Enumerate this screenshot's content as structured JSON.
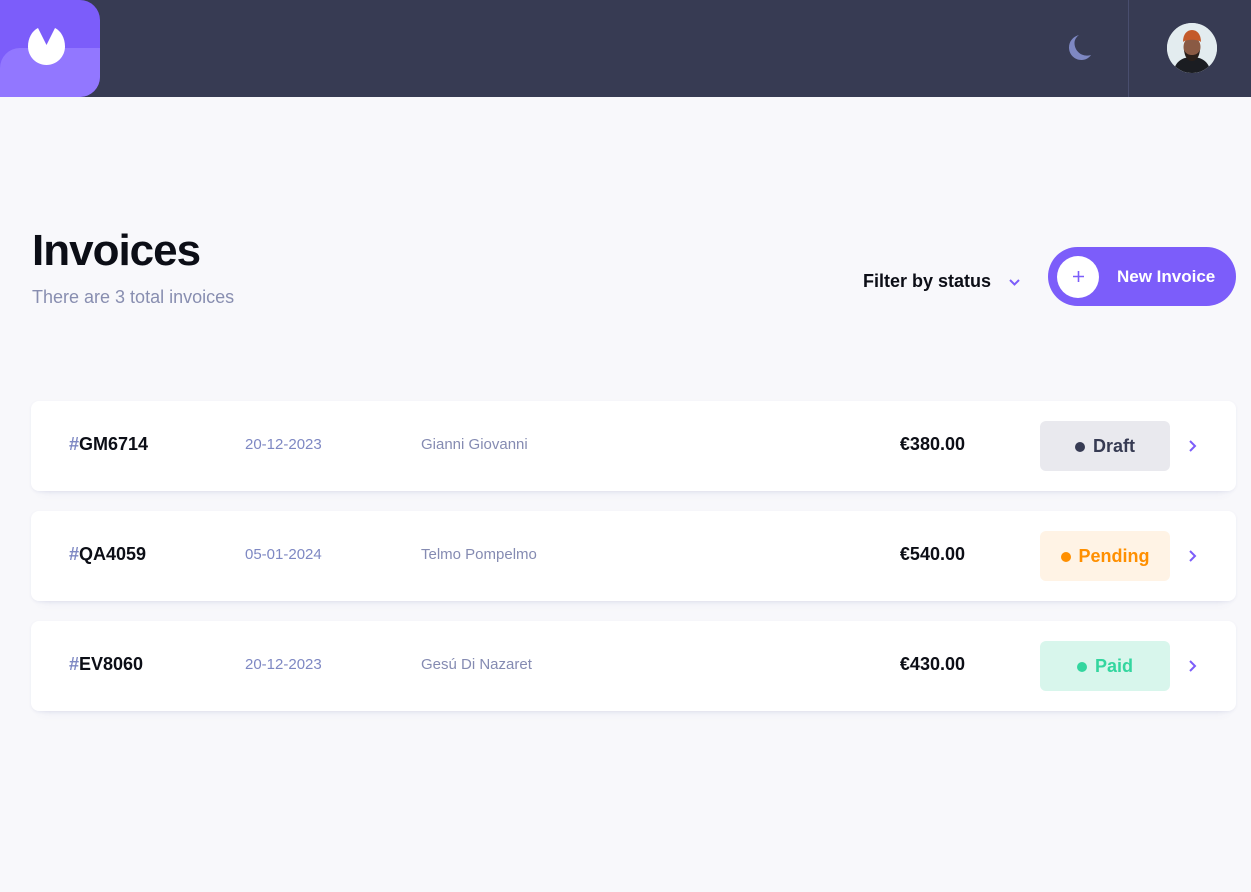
{
  "header": {
    "logo_icon": "brand-logo-icon",
    "theme_icon": "moon-icon",
    "avatar_alt": "user avatar"
  },
  "colors": {
    "accent": "#7c5dfa",
    "header_bg": "#373b53",
    "draft": "#373b53",
    "pending": "#ff8f00",
    "paid": "#33d69f"
  },
  "page": {
    "title": "Invoices",
    "subtitle": "There are 3 total invoices"
  },
  "filter": {
    "label": "Filter by status",
    "icon": "chevron-down-icon"
  },
  "new_invoice": {
    "label": "New Invoice",
    "icon": "plus-icon"
  },
  "invoices": [
    {
      "hash": "#",
      "id": "GM6714",
      "date": "20-12-2023",
      "client": "Gianni Giovanni",
      "amount": "€380.00",
      "status": "Draft",
      "status_key": "draft"
    },
    {
      "hash": "#",
      "id": "QA4059",
      "date": "05-01-2024",
      "client": "Telmo Pompelmo",
      "amount": "€540.00",
      "status": "Pending",
      "status_key": "pending"
    },
    {
      "hash": "#",
      "id": "EV8060",
      "date": "20-12-2023",
      "client": "Gesú Di Nazaret",
      "amount": "€430.00",
      "status": "Paid",
      "status_key": "paid"
    }
  ]
}
